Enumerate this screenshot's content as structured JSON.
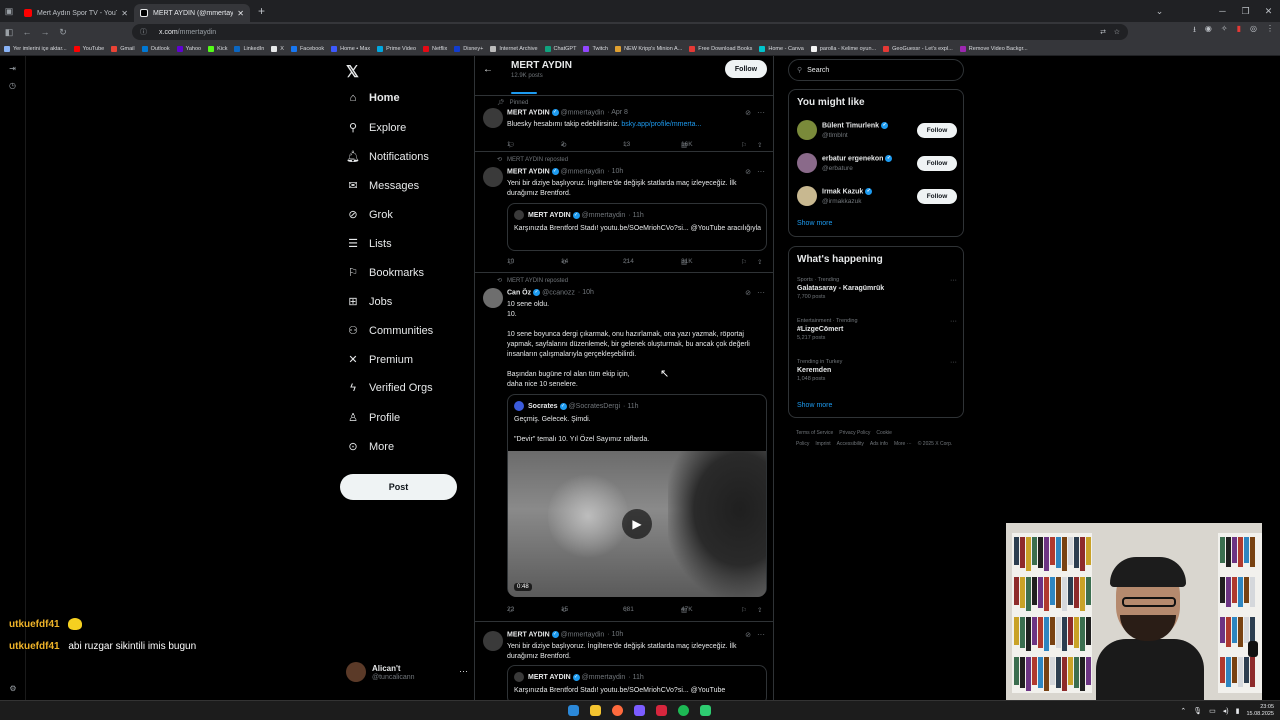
{
  "browser": {
    "tabs": [
      {
        "title": "Mert Aydın Spor TV - YouTube",
        "active": false,
        "favicon_color": "#ff0000"
      },
      {
        "title": "MERT AYDIN (@mmertaydin) / X",
        "active": true,
        "favicon_color": "#e7e9ea"
      }
    ],
    "new_tab": "+",
    "url_host": "x.com",
    "url_path": "/mmertaydin",
    "bookmarks": [
      "Yer imlerini içe aktar...",
      "YouTube",
      "Gmail",
      "Outlook",
      "Yahoo",
      "Kick",
      "LinkedIn",
      "X",
      "Facebook",
      "Home • Max",
      "Prime Video",
      "Netflix",
      "Disney+",
      "Internet Archive",
      "ChatGPT",
      "Twitch",
      "NEW Kripp's Minion A...",
      "Free Download Books",
      "Home - Canva",
      "parolla - Kelime oyun...",
      "GeoGuessr - Let's expl...",
      "Remove Video Backgr..."
    ]
  },
  "nav": {
    "items": [
      {
        "label": "Home",
        "icon": "home-icon",
        "glyph": "⌂",
        "bold": true
      },
      {
        "label": "Explore",
        "icon": "search-icon",
        "glyph": "⚲",
        "bold": false
      },
      {
        "label": "Notifications",
        "icon": "bell-icon",
        "glyph": "🔔︎",
        "bold": false
      },
      {
        "label": "Messages",
        "icon": "envelope-icon",
        "glyph": "✉",
        "bold": false
      },
      {
        "label": "Grok",
        "icon": "grok-icon",
        "glyph": "⊘",
        "bold": false
      },
      {
        "label": "Lists",
        "icon": "lists-icon",
        "glyph": "☰",
        "bold": false
      },
      {
        "label": "Bookmarks",
        "icon": "bookmark-icon",
        "glyph": "⚐",
        "bold": false
      },
      {
        "label": "Jobs",
        "icon": "briefcase-icon",
        "glyph": "⊞",
        "bold": false
      },
      {
        "label": "Communities",
        "icon": "communities-icon",
        "glyph": "⚇",
        "bold": false
      },
      {
        "label": "Premium",
        "icon": "x-premium-icon",
        "glyph": "✕",
        "bold": false
      },
      {
        "label": "Verified Orgs",
        "icon": "lightning-icon",
        "glyph": "ϟ",
        "bold": false
      },
      {
        "label": "Profile",
        "icon": "person-icon",
        "glyph": "♙",
        "bold": false
      },
      {
        "label": "More",
        "icon": "more-circle-icon",
        "glyph": "⊙",
        "bold": false
      }
    ],
    "post_label": "Post",
    "account": {
      "name": "Alican't",
      "handle": "@tuncalicann"
    }
  },
  "profile": {
    "name": "MERT AYDIN",
    "post_count": "12.9K posts",
    "follow_label": "Follow"
  },
  "tweets": [
    {
      "social": "Pinned",
      "name": "MERT AYDIN",
      "handle": "@mmertaydin",
      "time": "· Apr 8",
      "text": "Bluesky hesabımı takip edebilirsiniz. ",
      "link": "bsky.app/profile/mmerta...",
      "replies": "1",
      "reposts": "2",
      "likes": "13",
      "views": "16K"
    },
    {
      "social": "MERT AYDIN reposted",
      "name": "MERT AYDIN",
      "handle": "@mmertaydin",
      "time": "· 10h",
      "text": "Yeni bir diziye başlıyoruz. İngiltere'de değişik statlarda maç izleyeceğiz. İlk durağımız Brentford.",
      "quote": {
        "name": "MERT AYDIN",
        "handle": "@mmertaydin",
        "time": "· 11h",
        "text": "Karşınızda Brentford Stadı! youtu.be/SOeMriohCVo?si... @YouTube aracılığıyla"
      },
      "replies": "10",
      "reposts": "14",
      "likes": "214",
      "views": "31K"
    },
    {
      "social": "MERT AYDIN reposted",
      "name": "Can Öz",
      "handle": "@ccanozz",
      "time": "· 10h",
      "text": "10 sene oldu.\n10.\n\n10 sene boyunca dergi çıkarmak, onu hazırlamak, ona yazı yazmak, röportaj yapmak, sayfalarını düzenlemek, bir gelenek oluşturmak, bu ancak çok değerli insanların çalışmalarıyla gerçekleşebilirdi.\n\nBaşından bugüne rol alan tüm ekip için,\ndaha nice 10 senelere.",
      "quote": {
        "name": "Socrates",
        "handle": "@SocratesDergi",
        "time": "· 11h",
        "text": "Geçmiş. Gelecek. Şimdi.\n\n\"Devir\" temalı 10. Yıl Özel Sayımız raflarda.",
        "video_duration": "0:48"
      },
      "replies": "22",
      "reposts": "15",
      "likes": "681",
      "views": "47K"
    },
    {
      "social": "",
      "name": "MERT AYDIN",
      "handle": "@mmertaydin",
      "time": "· 10h",
      "text": "Yeni bir diziye başlıyoruz. İngiltere'de değişik statlarda maç izleyeceğiz. İlk durağımız Brentford.",
      "quote": {
        "name": "MERT AYDIN",
        "handle": "@mmertaydin",
        "time": "· 11h",
        "text": "Karşınızda Brentford Stadı! youtu.be/SOeMriohCVo?si... @YouTube"
      }
    }
  ],
  "sidebar": {
    "search_placeholder": "Search",
    "you_might_like": {
      "title": "You might like",
      "users": [
        {
          "name": "Bülent Timurlenk",
          "handle": "@tlmblnt",
          "follow": "Follow",
          "avatar_color": "#7a8a3a"
        },
        {
          "name": "erbatur ergenekon",
          "handle": "@erbature",
          "follow": "Follow",
          "avatar_color": "#8a6a8a"
        },
        {
          "name": "Irmak Kazuk",
          "handle": "@irmakkazuk",
          "follow": "Follow",
          "avatar_color": "#c8b890"
        }
      ],
      "show_more": "Show more"
    },
    "whats_happening": {
      "title": "What's happening",
      "trends": [
        {
          "category": "Sports · Trending",
          "title": "Galatasaray - Karagümrük",
          "count": "7,700 posts"
        },
        {
          "category": "Entertainment · Trending",
          "title": "#LizgeCömert",
          "count": "5,217 posts"
        },
        {
          "category": "Trending in Turkey",
          "title": "Keremden",
          "count": "1,048 posts"
        }
      ],
      "show_more": "Show more"
    },
    "footer": [
      "Terms of Service",
      "Privacy Policy",
      "Cookie Policy",
      "Imprint",
      "Accessibility",
      "Ads info",
      "More ···",
      "© 2025 X Corp."
    ]
  },
  "chat": [
    {
      "user": "utkuefdf41",
      "message": ""
    },
    {
      "user": "utkuefdf41",
      "message": "abi ruzgar sikintili imis bugun"
    }
  ],
  "taskbar": {
    "time": "23:05",
    "date": "15.08.2025"
  }
}
